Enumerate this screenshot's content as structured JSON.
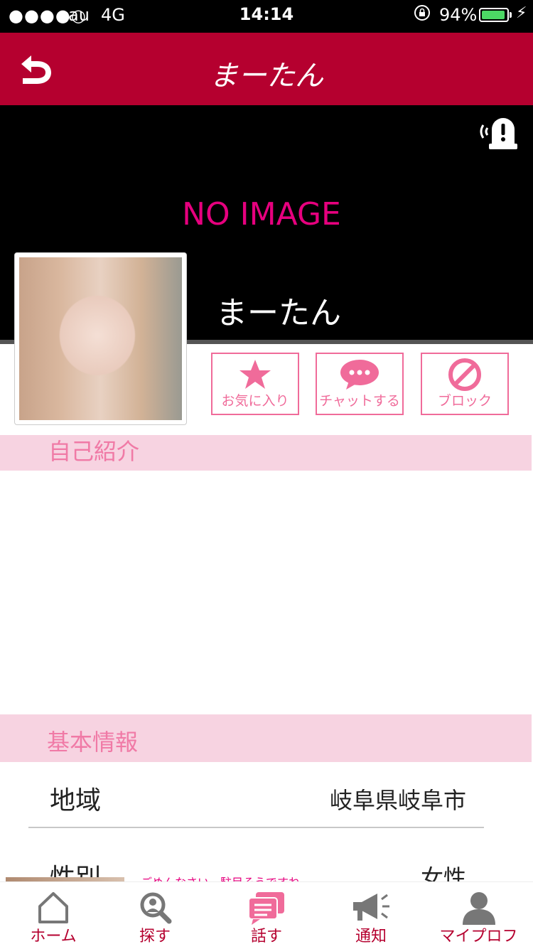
{
  "status_bar": {
    "signal": "●●●●○",
    "carrier": "au",
    "network": "4G",
    "time": "14:14",
    "battery_percent": "94%",
    "battery_level": 0.94
  },
  "header": {
    "title": "まーたん",
    "back_icon": "undo-arrow-icon",
    "color": "#b5002f"
  },
  "cover": {
    "no_image_text": "NO IMAGE",
    "name": "まーたん",
    "report_icon": "report-alarm-icon"
  },
  "actions": [
    {
      "label": "お気に入り",
      "icon": "star-icon"
    },
    {
      "label": "チャットする",
      "icon": "chat-bubble-icon"
    },
    {
      "label": "ブロック",
      "icon": "block-icon"
    }
  ],
  "sections": {
    "intro_title": "自己紹介",
    "basic_title": "基本情報"
  },
  "basic_info": [
    {
      "label": "地域",
      "value": "岐阜県岐阜市"
    },
    {
      "label": "性別",
      "value": "女性"
    }
  ],
  "peek_message": "ごめんなさい　駐目そうですね",
  "tabs": [
    {
      "label": "ホーム",
      "icon": "home-icon"
    },
    {
      "label": "探す",
      "icon": "search-icon"
    },
    {
      "label": "話す",
      "icon": "talk-icon"
    },
    {
      "label": "通知",
      "icon": "megaphone-icon"
    },
    {
      "label": "マイプロフ",
      "icon": "profile-icon"
    }
  ],
  "colors": {
    "accent": "#b5002f",
    "pink": "#f06b9a",
    "section_bg": "#f7d3e1",
    "no_image": "#e6007e"
  }
}
